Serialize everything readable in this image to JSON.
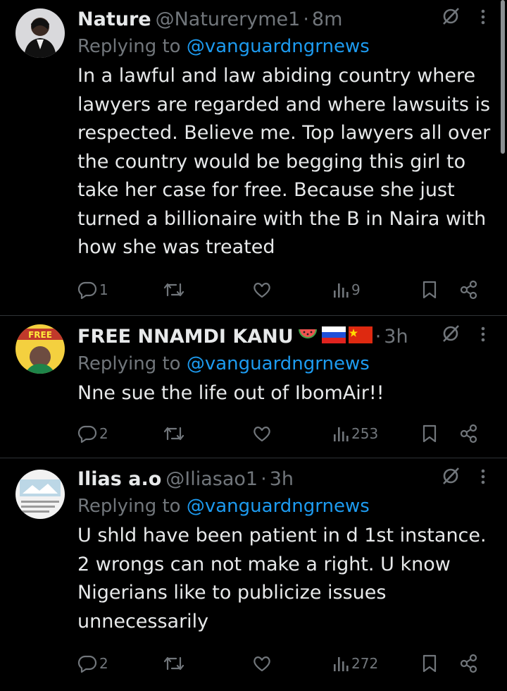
{
  "replies": [
    {
      "display_name": "Nature",
      "handle": "@Natureryme1",
      "separator": "·",
      "time": "8m",
      "replying_prefix": "Replying to",
      "replying_to": "@vanguardngrnews",
      "text": "In a lawful and law abiding country where lawyers are regarded and where lawsuits is respected. Believe me. Top lawyers all over the country would be begging this girl to take her case for free. Because she just turned a billionaire with the B in Naira with how she was treated",
      "reply_count": "1",
      "repost_count": "",
      "like_count": "",
      "view_count": "9"
    },
    {
      "display_name": "FREE NNAMDI KANU",
      "handle": "",
      "separator": "·",
      "time": "3h",
      "replying_prefix": "Replying to",
      "replying_to": "@vanguardngrnews",
      "text": "Nne sue the life out of IbomAir!!",
      "reply_count": "2",
      "repost_count": "",
      "like_count": "",
      "view_count": "253",
      "avatar_text": "FREE"
    },
    {
      "display_name": "Ilias a.o",
      "handle": "@Iliasao1",
      "separator": "·",
      "time": "3h",
      "replying_prefix": "Replying to",
      "replying_to": "@vanguardngrnews",
      "text": "U shld have been patient in d 1st instance. 2 wrongs can not make a right. U know Nigerians like to publicize issues unnecessarily",
      "reply_count": "2",
      "repost_count": "",
      "like_count": "",
      "view_count": "272"
    }
  ],
  "icons": {
    "grok": "grok-icon",
    "more": "more-dots-icon",
    "reply": "reply-bubble-icon",
    "repost": "repost-arrows-icon",
    "like": "heart-icon",
    "views": "views-bars-icon",
    "bookmark": "bookmark-icon",
    "share": "share-icon",
    "flags": [
      "watermelon",
      "russia-flag",
      "china-flag"
    ]
  },
  "colors": {
    "background": "#000000",
    "text": "#e7e9ea",
    "muted": "#71767b",
    "link": "#1d9bf0",
    "divider": "#2f3336"
  }
}
